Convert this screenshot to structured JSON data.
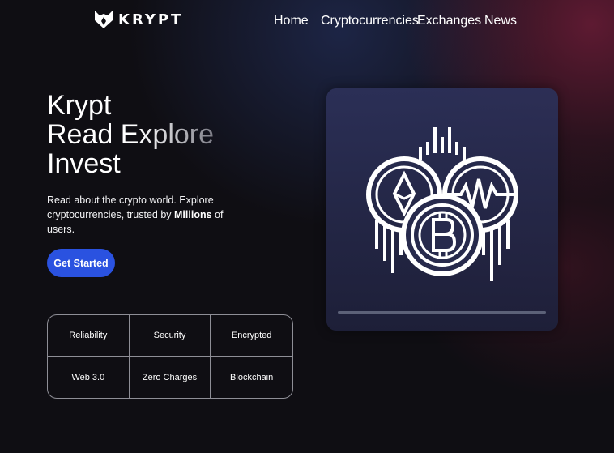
{
  "brand": {
    "name": "KRYPT",
    "logo_icon": "fox-head-icon"
  },
  "nav": {
    "items": [
      "Home",
      "Cryptocurrencies",
      "Exchanges",
      "News"
    ]
  },
  "hero": {
    "line1": "Krypt",
    "line2": "Read Explore",
    "line3": "Invest",
    "desc_part1": "Read about the crypto world. Explore cryptocurrencies, trusted by ",
    "desc_bold": "Millions",
    "desc_part2": " of users.",
    "cta_label": "Get Started"
  },
  "features": [
    "Reliability",
    "Security",
    "Encrypted",
    "Web 3.0",
    "Zero Charges",
    "Blockchain"
  ],
  "card": {
    "icon": "crypto-coins-icon"
  },
  "colors": {
    "accent": "#2a52e0",
    "background": "#0f0e13",
    "card": "#2c3058"
  }
}
